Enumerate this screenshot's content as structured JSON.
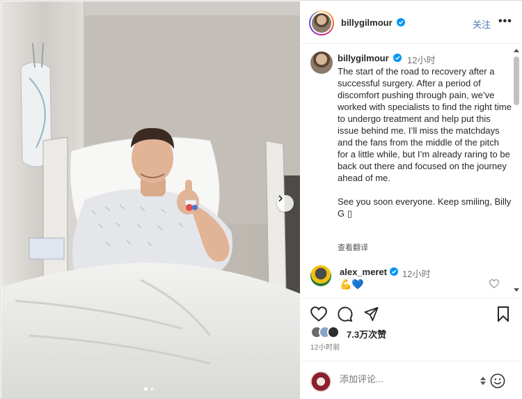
{
  "post": {
    "author": "billygilmour",
    "follow_label": "关注",
    "more_label": "•••",
    "caption_author": "billygilmour",
    "caption_time": "12小时",
    "caption": "The start of the road to recovery after a successful surgery. After a period of discomfort pushing through pain, we’ve worked with specialists to find the right time to undergo treatment and help put this issue behind me. I’ll miss the matchdays and the fans from the middle of the pitch for a little while, but I’m already raring to be back out there and focused on the journey ahead of me.\n\nSee you soon everyone. Keep smiling, Billy G ▯",
    "translate_label": "查看翻译",
    "comment": {
      "author": "alex_meret",
      "time": "12小时",
      "text": "💪💙"
    },
    "likes": "7.3万次赞",
    "posted_ago": "12小时前",
    "comment_placeholder": "添加评论...",
    "carousel": {
      "slides": 2,
      "active": 1
    }
  },
  "colors": {
    "verified": "#0095f6",
    "follow": "#4a7ab5",
    "story_ring": [
      "#feda75",
      "#fa7e1e",
      "#d62976",
      "#962fbf",
      "#4f5bd5"
    ]
  },
  "icons": [
    "heart-icon",
    "comment-icon",
    "share-icon",
    "bookmark-icon",
    "emoji-icon",
    "chevron-right-icon",
    "verified-icon",
    "more-icon"
  ]
}
